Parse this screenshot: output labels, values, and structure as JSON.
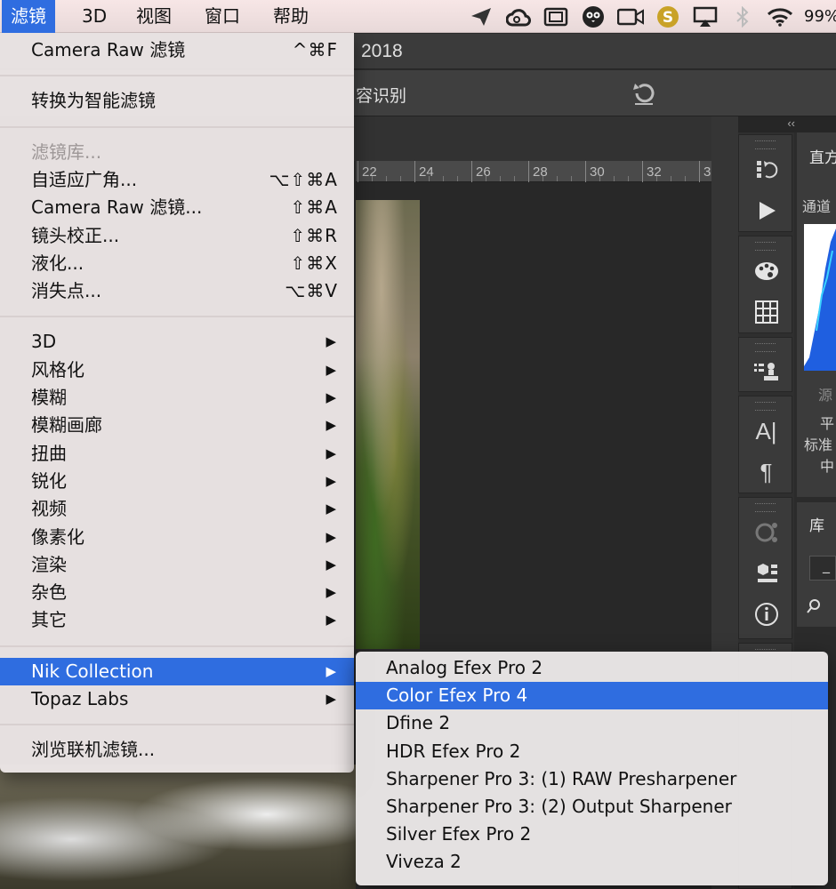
{
  "menubar": {
    "items": [
      "滤镜",
      "3D",
      "视图",
      "窗口",
      "帮助"
    ],
    "active_index": 0,
    "battery": "99%",
    "tray_icons": [
      "send-icon",
      "creative-cloud-icon",
      "screen-icon",
      "owl-icon",
      "camera-icon",
      "s-app-icon",
      "airplay-icon",
      "bluetooth-icon",
      "wifi-icon"
    ]
  },
  "photoshop": {
    "title_fragment": "2018",
    "options_fragment": "容识别",
    "ruler_labels": [
      "22",
      "24",
      "26",
      "28",
      "30",
      "32",
      "3"
    ],
    "panel_collapse": "‹‹",
    "histogram_panel": {
      "title": "直方",
      "channel": "通道",
      "source": "源",
      "lines": [
        "平",
        "标准",
        "中"
      ]
    },
    "library_panel": {
      "title": "库",
      "field": "_"
    }
  },
  "filter_menu": {
    "items": [
      {
        "label": "Camera Raw 滤镜",
        "shortcut": "^⌘F"
      },
      {
        "type": "separator"
      },
      {
        "label": "转换为智能滤镜"
      },
      {
        "type": "separator"
      },
      {
        "label": "滤镜库...",
        "disabled": true
      },
      {
        "label": "自适应广角...",
        "shortcut": "⌥⇧⌘A"
      },
      {
        "label": "Camera Raw 滤镜...",
        "shortcut": "⇧⌘A"
      },
      {
        "label": "镜头校正...",
        "shortcut": "⇧⌘R"
      },
      {
        "label": "液化...",
        "shortcut": "⇧⌘X"
      },
      {
        "label": "消失点...",
        "shortcut": "⌥⌘V"
      },
      {
        "type": "separator"
      },
      {
        "label": "3D",
        "submenu": true
      },
      {
        "label": "风格化",
        "submenu": true
      },
      {
        "label": "模糊",
        "submenu": true
      },
      {
        "label": "模糊画廊",
        "submenu": true
      },
      {
        "label": "扭曲",
        "submenu": true
      },
      {
        "label": "锐化",
        "submenu": true
      },
      {
        "label": "视频",
        "submenu": true
      },
      {
        "label": "像素化",
        "submenu": true
      },
      {
        "label": "渲染",
        "submenu": true
      },
      {
        "label": "杂色",
        "submenu": true
      },
      {
        "label": "其它",
        "submenu": true
      },
      {
        "type": "separator"
      },
      {
        "label": "Nik Collection",
        "submenu": true,
        "highlighted": true
      },
      {
        "label": "Topaz Labs",
        "submenu": true
      },
      {
        "type": "separator"
      },
      {
        "label": "浏览联机滤镜..."
      }
    ],
    "submenu_arrow": "▶"
  },
  "nik_submenu": {
    "items": [
      {
        "label": "Analog Efex Pro 2"
      },
      {
        "label": "Color Efex Pro 4",
        "highlighted": true
      },
      {
        "label": "Dfine 2"
      },
      {
        "label": "HDR Efex Pro 2"
      },
      {
        "label": "Sharpener Pro 3: (1) RAW Presharpener"
      },
      {
        "label": "Sharpener Pro 3: (2) Output Sharpener"
      },
      {
        "label": "Silver Efex Pro 2"
      },
      {
        "label": "Viveza 2"
      }
    ]
  },
  "colors": {
    "highlight": "#2f6de0",
    "menu_bg": "#ece6e6",
    "ps_dark": "#2b2b2b"
  }
}
